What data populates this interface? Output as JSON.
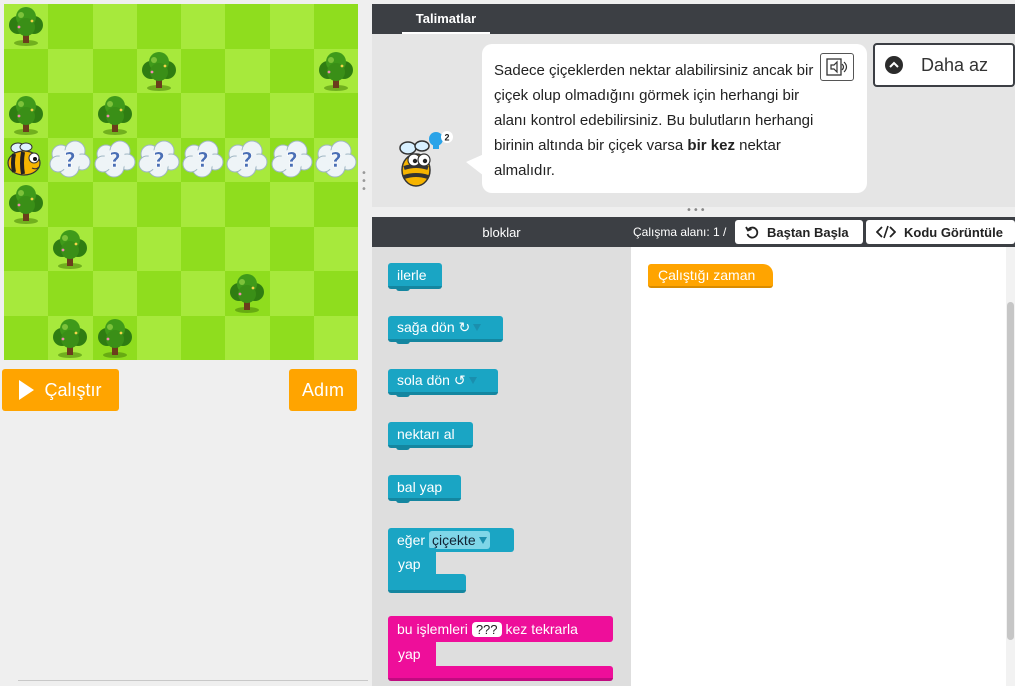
{
  "game": {
    "run_label": "Çalıştır",
    "step_label": "Adım",
    "grid": {
      "cols": 8,
      "rows": 8
    },
    "trees": [
      [
        0,
        0
      ],
      [
        3,
        1
      ],
      [
        7,
        1
      ],
      [
        0,
        2
      ],
      [
        2,
        2
      ],
      [
        0,
        4
      ],
      [
        1,
        5
      ],
      [
        5,
        6
      ],
      [
        1,
        7
      ],
      [
        2,
        7
      ]
    ],
    "bee": [
      0,
      3
    ],
    "clouds": [
      [
        1,
        3
      ],
      [
        2,
        3
      ],
      [
        3,
        3
      ],
      [
        4,
        3
      ],
      [
        5,
        3
      ],
      [
        6,
        3
      ],
      [
        7,
        3
      ]
    ]
  },
  "instructions": {
    "tab_label": "Talimatlar",
    "text_before": "Sadece çiçeklerden nektar alabilirsiniz ancak bir çiçek olup olmadığını görmek için herhangi bir alanı kontrol edebilirsiniz. Bu bulutların herhangi birinin altında bir çiçek varsa ",
    "text_bold": "bir kez",
    "text_after": " nektar almalıdır.",
    "hint_count": "2",
    "less_label": "Daha az"
  },
  "workspace": {
    "toolbox_title": "bloklar",
    "workspace_label": "Çalışma alanı: 1 /",
    "reset_label": "Baştan Başla",
    "show_code_label": "Kodu Görüntüle",
    "when_run_label": "Çalıştığı zaman"
  },
  "blocks": {
    "move_forward": "ilerle",
    "turn_right": "sağa dön ↻",
    "turn_left": "sola dön ↺",
    "get_nectar": "nektarı al",
    "make_honey": "bal yap",
    "if_label": "eğer",
    "if_condition": "çiçekte",
    "do_label": "yap",
    "repeat_label": "bu işlemleri",
    "repeat_count": "???",
    "repeat_suffix": "kez tekrarla",
    "repeat_do": "yap"
  },
  "colors": {
    "accent_orange": "#ffa400",
    "block_cyan": "#1aa5c4",
    "block_pink": "#ee0e9a",
    "header_dark": "#3c3f44",
    "grass_light": "#a7e93c",
    "grass_dark": "#8fdd1e"
  }
}
